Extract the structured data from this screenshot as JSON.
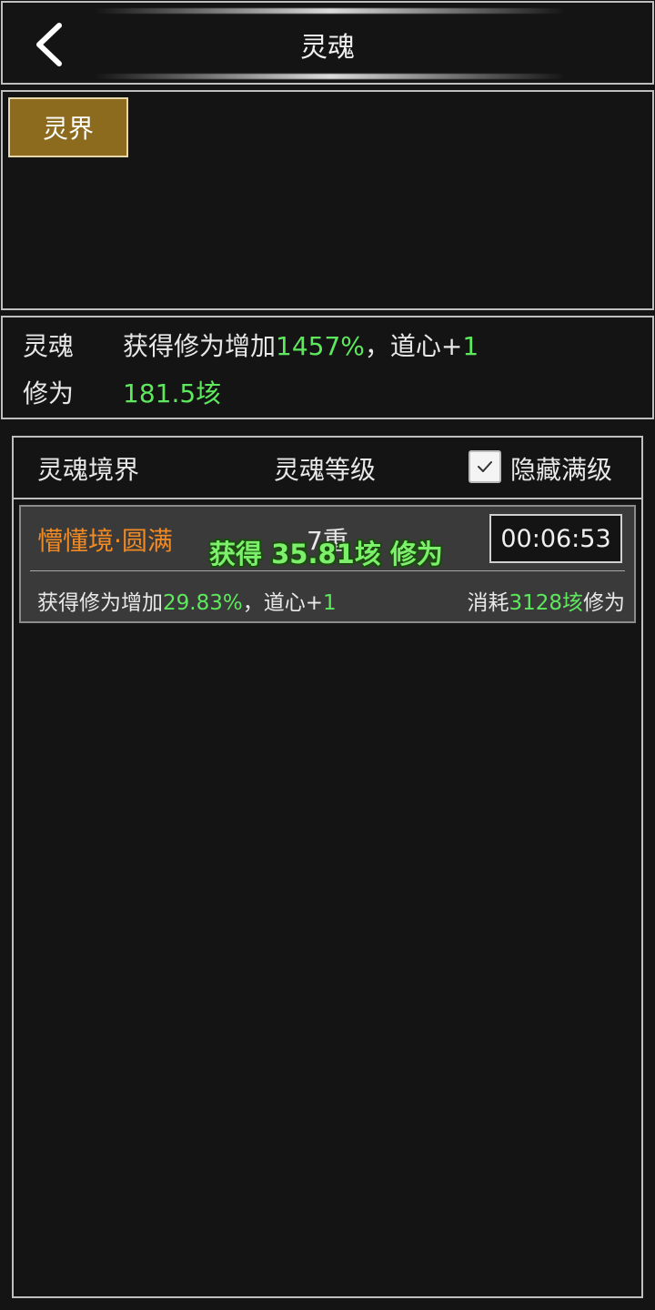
{
  "header": {
    "title": "灵魂",
    "back_icon": "chevron-left-icon"
  },
  "tabs": [
    {
      "label": "灵界",
      "active": true
    }
  ],
  "stats": {
    "soul": {
      "label": "灵魂",
      "text_prefix": "获得修为增加",
      "percent": "1457%",
      "text_mid": "，道心+",
      "daoxin": "1"
    },
    "cultivation": {
      "label": "修为",
      "value": "181.5垓"
    }
  },
  "list": {
    "columns": [
      "灵魂境界",
      "灵魂等级"
    ],
    "hide_max": {
      "label": "隐藏满级",
      "checked": true
    },
    "items": [
      {
        "realm": "懵懂境·圆满",
        "level": "7重",
        "timer": "00:06:53",
        "bonus_prefix": "获得修为增加",
        "bonus_percent": "29.83%",
        "bonus_mid": "，道心+",
        "bonus_daoxin": "1",
        "cost_prefix": "消耗",
        "cost_value": "3128垓",
        "cost_suffix": "修为"
      }
    ]
  },
  "floating_text": "获得 35.81垓 修为",
  "colors": {
    "background": "#141414",
    "border": "#bfbfbf",
    "tab_active": "#8c6b1e",
    "highlight_green": "#5ee85e",
    "realm_orange": "#f08a24"
  }
}
